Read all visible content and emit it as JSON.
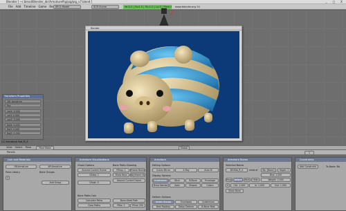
{
  "window": {
    "title": "Blender [ ~/.blend/Blender_dir/ArmaturePig/pig/pig_v7.blend ]",
    "controls": [
      "_",
      "□",
      "X"
    ]
  },
  "menubar": {
    "items": [
      "File",
      "Add",
      "Timeline",
      "Game",
      "Render",
      "Help"
    ],
    "screen_field": "SR:2-Model",
    "scene_field": "SCE:Scene",
    "www": "www.blender.org 245",
    "status": "Ve:0-0 | Fa:0-0 | Ob:1-0 | La:0 | Mem:4.4M"
  },
  "render": {
    "title": "Render"
  },
  "numeric_panel": {
    "title": "Transform Properties",
    "fields": [
      "OB: Armature",
      "Par:",
      "LocX: 0.000",
      "LocY: 0.000",
      "LocZ: 0.000",
      "RotX: 0.000",
      "RotY: 0.000",
      "RotZ: 0.000"
    ]
  },
  "view3d": {
    "coord": "(1) Armature Bat_R_4",
    "header": [
      "View",
      "Select",
      "Pose"
    ],
    "mode": "Pose Mode",
    "layer": "Global"
  },
  "buttons_header": {
    "items": [
      "Panels"
    ],
    "frame": "1"
  },
  "panels": {
    "link": {
      "title": "Link and Materials",
      "ob": "OB:Armature",
      "arm": "AR:Armature",
      "posel": "Pose Library",
      "bonegroups": "Bone Groups",
      "addgroup": "Add Group",
      "n0": "0"
    },
    "vis": {
      "title": "Armature Visualizations",
      "ghost": "Ghost Options",
      "arround": "Around Current Frame",
      "step": "GStep: 1",
      "ghost2": "Ghost: 0",
      "bonepaths": "Bone Paths Drawing",
      "pstep": "PStep: 1",
      "frames": "Frame Nums",
      "showkeys": "Show Keys",
      "keyframe": "Keyframe Nums",
      "around2": "Around Current Frame",
      "bonepathcalc": "Bone Paths Calc",
      "calc": "Calculate Paths",
      "clear": "Clear Paths",
      "headpath": "Bone-Head Path",
      "psta": "PSta: 1",
      "pend": "PEnd: 250"
    },
    "arm": {
      "title": "Armature",
      "editing": "Editing Options",
      "xaxis": "X-Axis Mirror",
      "xray": "X-Ray",
      "autoik": "Auto IK",
      "display": "Display Options",
      "octa": "Octahedron",
      "stick": "Stick",
      "bbone": "B-Bone",
      "envelope": "Envelope",
      "names": "Draw Names",
      "axes": "Axes",
      "shapes": "Shapes",
      "colors": "Colors",
      "deform": "Deform Options",
      "vgroups": "Vertex Groups",
      "envelopes": "Envelopes",
      "quat": "Quaternion",
      "restpos": "Rest Position",
      "delay": "Delay Deform",
      "bbrest": "B-Bone Rest"
    },
    "bones": {
      "title": "Armature Bones",
      "selected": "Selected Bones",
      "bo": "BO:Bat_R_4",
      "child": "child of",
      "parent": "Bo: [None]",
      "seg": "Segm: 1",
      "dist": "Dist: 1.000",
      "weight": "Weight: 1.000",
      "hinge": "Hinge",
      "deform": "Deform",
      "mult": "Mult",
      "hide": "Hide",
      "scale": "S",
      "ctrl": "Ctrl: 1.000",
      "inout": "In: 1.000",
      "out": "Out: 1.000",
      "showbone": "Show Bone"
    },
    "constraints": {
      "title": "Constraints",
      "add": "Add Constraint",
      "tobone": "To Bone: Ba"
    }
  },
  "colors": {
    "accent": "#6b7892",
    "status_green": "#6ac05a",
    "render_bg": "#0c3a78",
    "pig_skin": "#e8d6a6",
    "stripe_blue": "#3aa4dc"
  }
}
